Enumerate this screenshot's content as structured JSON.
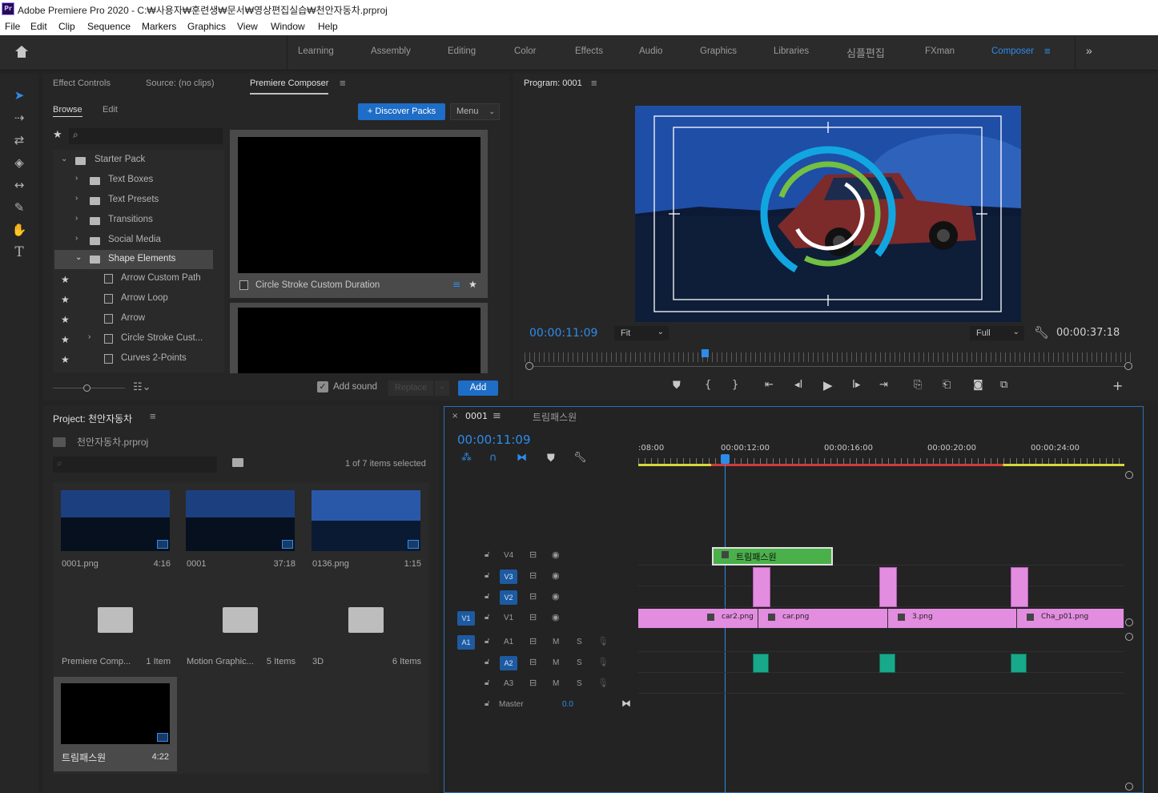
{
  "window": {
    "title": "Adobe Premiere Pro 2020 - C:₩사용자₩훈련생₩문서₩영상편집실습₩천안자동차.prproj",
    "app_icon": "Pr"
  },
  "menu": [
    "File",
    "Edit",
    "Clip",
    "Sequence",
    "Markers",
    "Graphics",
    "View",
    "Window",
    "Help"
  ],
  "workspaces": [
    "Learning",
    "Assembly",
    "Editing",
    "Color",
    "Effects",
    "Audio",
    "Graphics",
    "Libraries",
    "심플편집",
    "FXman",
    "Composer"
  ],
  "active_workspace": "Composer",
  "source_panel": {
    "tabs": [
      "Effect Controls",
      "Source: (no clips)",
      "Premiere Composer"
    ],
    "active_tab": "Premiere Composer",
    "subtabs": [
      "Browse",
      "Edit"
    ],
    "discover_label": "+ Discover Packs",
    "menu_label": "Menu",
    "tree": [
      {
        "label": "Starter Pack",
        "type": "folder",
        "expanded": true
      },
      {
        "label": "Text Boxes",
        "type": "folder"
      },
      {
        "label": "Text Presets",
        "type": "folder"
      },
      {
        "label": "Transitions",
        "type": "folder"
      },
      {
        "label": "Social Media",
        "type": "folder"
      },
      {
        "label": "Shape Elements",
        "type": "folder",
        "expanded": true,
        "selected": true
      },
      {
        "label": "Arrow Custom Path",
        "type": "item"
      },
      {
        "label": "Arrow Loop",
        "type": "item"
      },
      {
        "label": "Arrow",
        "type": "item"
      },
      {
        "label": "Circle Stroke Cust...",
        "type": "item"
      },
      {
        "label": "Curves 2-Points",
        "type": "item"
      }
    ],
    "preview_label": "Circle Stroke Custom Duration",
    "add_sound_label": "Add sound",
    "replace_label": "Replace",
    "add_label": "Add"
  },
  "program": {
    "tab": "Program: 0001",
    "timecode_current": "00:00:11:09",
    "fit": "Fit",
    "quality": "Full",
    "timecode_total": "00:00:37:18"
  },
  "project": {
    "title": "Project: 천안자동차",
    "file": "천안자동차.prproj",
    "selection": "1 of 7 items selected",
    "items": [
      {
        "name": "0001.png",
        "meta": "4:16",
        "kind": "image"
      },
      {
        "name": "0001",
        "meta": "37:18",
        "kind": "sequence"
      },
      {
        "name": "0136.png",
        "meta": "1:15",
        "kind": "image"
      },
      {
        "name": "Premiere Comp...",
        "meta": "1 Item",
        "kind": "bin"
      },
      {
        "name": "Motion Graphic...",
        "meta": "5 Items",
        "kind": "bin"
      },
      {
        "name": "3D",
        "meta": "6 Items",
        "kind": "bin"
      },
      {
        "name": "트림패스원",
        "meta": "4:22",
        "kind": "sequence"
      }
    ]
  },
  "timeline": {
    "tabs": [
      "0001",
      "트림패스원"
    ],
    "timecode": "00:00:11:09",
    "ruler": [
      ":08:00",
      "00:00:12:00",
      "00:00:16:00",
      "00:00:20:00",
      "00:00:24:00"
    ],
    "video_tracks": [
      "V4",
      "V3",
      "V2",
      "V1"
    ],
    "audio_tracks": [
      "A1",
      "A2",
      "A3"
    ],
    "source_patch": {
      "video": "V1",
      "audio": "A1"
    },
    "master_label": "Master",
    "master_value": "0.0",
    "clips": {
      "v4": "트림패스원",
      "v1": [
        "car2.png",
        "car.png",
        "3.png",
        "Cha_p01.png"
      ]
    },
    "track_buttons": {
      "mute": "M",
      "solo": "S"
    }
  },
  "colors": {
    "accent": "#2d8ceb",
    "clip_pink": "#e28de0",
    "clip_green": "#49b04a",
    "audio_teal": "#18a88a"
  }
}
